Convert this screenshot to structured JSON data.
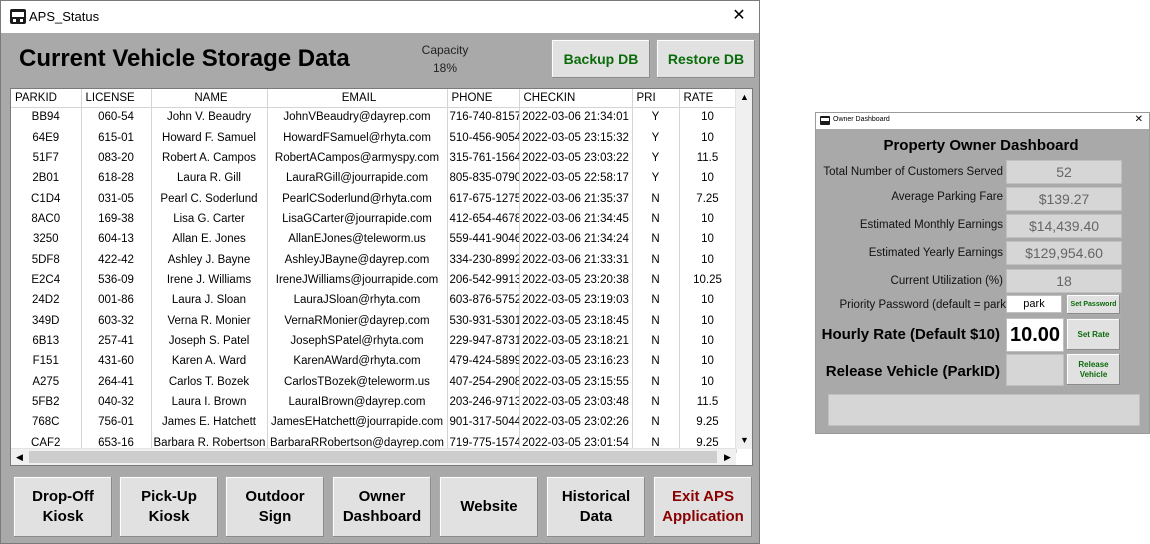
{
  "main_window": {
    "title": "APS_Status",
    "close_glyph": "✕",
    "heading": "Current Vehicle Storage Data",
    "capacity_label": "Capacity",
    "capacity_value": "18%",
    "backup_label": "Backup DB",
    "restore_label": "Restore DB"
  },
  "table": {
    "columns": [
      "PARKID",
      "LICENSE",
      "NAME",
      "EMAIL",
      "PHONE",
      "CHECKIN",
      "PRI",
      "RATE"
    ],
    "rows": [
      [
        "BB94",
        "060-54",
        "John V. Beaudry",
        "JohnVBeaudry@dayrep.com",
        "716-740-8157",
        "2022-03-06 21:34:01",
        "Y",
        "10"
      ],
      [
        "64E9",
        "615-01",
        "Howard F. Samuel",
        "HowardFSamuel@rhyta.com",
        "510-456-9054",
        "2022-03-05 23:15:32",
        "Y",
        "10"
      ],
      [
        "51F7",
        "083-20",
        "Robert A. Campos",
        "RobertACampos@armyspy.com",
        "315-761-1564",
        "2022-03-05 23:03:22",
        "Y",
        "11.5"
      ],
      [
        "2B01",
        "618-28",
        "Laura R. Gill",
        "LauraRGill@jourrapide.com",
        "805-835-0790",
        "2022-03-05 22:58:17",
        "Y",
        "10"
      ],
      [
        "C1D4",
        "031-05",
        "Pearl C. Soderlund",
        "PearlCSoderlund@rhyta.com",
        "617-675-1275",
        "2022-03-06 21:35:37",
        "N",
        "7.25"
      ],
      [
        "8AC0",
        "169-38",
        "Lisa G. Carter",
        "LisaGCarter@jourrapide.com",
        "412-654-4678",
        "2022-03-06 21:34:45",
        "N",
        "10"
      ],
      [
        "3250",
        "604-13",
        "Allan E. Jones",
        "AllanEJones@teleworm.us",
        "559-441-9046",
        "2022-03-06 21:34:24",
        "N",
        "10"
      ],
      [
        "5DF8",
        "422-42",
        "Ashley J. Bayne",
        "AshleyJBayne@dayrep.com",
        "334-230-8992",
        "2022-03-06 21:33:31",
        "N",
        "10"
      ],
      [
        "E2C4",
        "536-09",
        "Irene J. Williams",
        "IreneJWilliams@jourrapide.com",
        "206-542-9913",
        "2022-03-05 23:20:38",
        "N",
        "10.25"
      ],
      [
        "24D2",
        "001-86",
        "Laura J. Sloan",
        "LauraJSloan@rhyta.com",
        "603-876-5752",
        "2022-03-05 23:19:03",
        "N",
        "10"
      ],
      [
        "349D",
        "603-32",
        "Verna R. Monier",
        "VernaRMonier@dayrep.com",
        "530-931-5301",
        "2022-03-05 23:18:45",
        "N",
        "10"
      ],
      [
        "6B13",
        "257-41",
        "Joseph S. Patel",
        "JosephSPatel@rhyta.com",
        "229-947-8731",
        "2022-03-05 23:18:21",
        "N",
        "10"
      ],
      [
        "F151",
        "431-60",
        "Karen A. Ward",
        "KarenAWard@rhyta.com",
        "479-424-5899",
        "2022-03-05 23:16:23",
        "N",
        "10"
      ],
      [
        "A275",
        "264-41",
        "Carlos T. Bozek",
        "CarlosTBozek@teleworm.us",
        "407-254-2908",
        "2022-03-05 23:15:55",
        "N",
        "10"
      ],
      [
        "5FB2",
        "040-32",
        "Laura I. Brown",
        "LauraIBrown@dayrep.com",
        "203-246-9713",
        "2022-03-05 23:03:48",
        "N",
        "11.5"
      ],
      [
        "768C",
        "756-01",
        "James E. Hatchett",
        "JamesEHatchett@jourrapide.com",
        "901-317-5044",
        "2022-03-05 23:02:26",
        "N",
        "9.25"
      ],
      [
        "CAF2",
        "653-16",
        "Barbara R. Robertson",
        "BarbaraRRobertson@dayrep.com",
        "719-775-1574",
        "2022-03-05 23:01:54",
        "N",
        "9.25"
      ]
    ]
  },
  "bottom_buttons": [
    {
      "line1": "Drop-Off",
      "line2": "Kiosk"
    },
    {
      "line1": "Pick-Up",
      "line2": "Kiosk"
    },
    {
      "line1": "Outdoor",
      "line2": "Sign"
    },
    {
      "line1": "Owner",
      "line2": "Dashboard"
    },
    {
      "line1": "Website",
      "line2": ""
    },
    {
      "line1": "Historical",
      "line2": "Data"
    },
    {
      "line1": "Exit APS",
      "line2": "Application"
    }
  ],
  "dashboard": {
    "title": "Owner Dashboard",
    "close_glyph": "✕",
    "heading": "Property Owner Dashboard",
    "stats": [
      {
        "label": "Total Number of Customers Served",
        "value": "52"
      },
      {
        "label": "Average Parking Fare",
        "value": "$139.27"
      },
      {
        "label": "Estimated Monthly Earnings",
        "value": "$14,439.40"
      },
      {
        "label": "Estimated Yearly Earnings",
        "value": "$129,954.60"
      },
      {
        "label": "Current Utilization (%)",
        "value": "18"
      }
    ],
    "password_label": "Priority Password (default = park",
    "password_value": "park",
    "set_password_label": "Set Password",
    "rate_label": "Hourly Rate (Default $10)",
    "rate_value": "10.00",
    "set_rate_label": "Set Rate",
    "release_label": "Release Vehicle (ParkID)",
    "release_btn_line1": "Release",
    "release_btn_line2": "Vehicle"
  },
  "colors": {
    "window_bg": "#a9a9a9",
    "green_text": "#0a6b0a",
    "exit_text": "#8b0000"
  }
}
